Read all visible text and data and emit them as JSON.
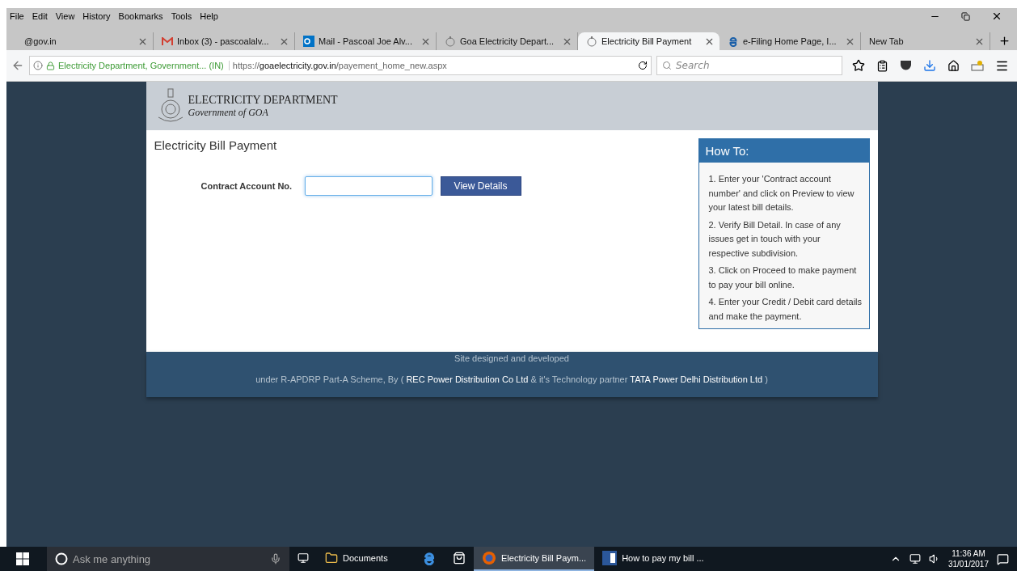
{
  "menu_bar": [
    "File",
    "Edit",
    "View",
    "History",
    "Bookmarks",
    "Tools",
    "Help"
  ],
  "tabs": [
    {
      "label": "@gov.in",
      "selected": false
    },
    {
      "label": "Inbox (3) - pascoalalv...",
      "selected": false
    },
    {
      "label": "Mail - Pascoal Joe Alv...",
      "selected": false
    },
    {
      "label": "Goa Electricity Depart...",
      "selected": false
    },
    {
      "label": "Electricity Bill Payment",
      "selected": true
    },
    {
      "label": "e-Filing Home Page, I...",
      "selected": false
    },
    {
      "label": "New Tab",
      "selected": false
    }
  ],
  "address_bar": {
    "site_identity": "Electricity Department, Government... (IN)",
    "url_prefix": "https://",
    "url_domain": "goaelectricity.gov.in",
    "url_path": "/payement_home_new.aspx"
  },
  "search": {
    "placeholder": "Search"
  },
  "page": {
    "header": {
      "title": "ELECTRICITY DEPARTMENT",
      "subtitle": "Government of GOA"
    },
    "heading": "Electricity Bill Payment",
    "form": {
      "label": "Contract Account No.",
      "button": "View Details"
    },
    "how_to": {
      "title": "How To:",
      "steps": [
        "1. Enter your 'Contract account number' and click on Preview to view your latest bill details.",
        "2. Verify Bill Detail. In case of any issues get in touch with your respective subdivision.",
        "3. Click on Proceed to make payment to pay your bill online.",
        "4. Enter your Credit / Debit card details and make the payment."
      ]
    },
    "footer": {
      "line_1": "Site designed and developed",
      "line_2": [
        {
          "kind": "plain",
          "text": "under R-APDRP Part-A Scheme, By ("
        },
        {
          "kind": "link",
          "text": "REC Power Distribution Co Ltd"
        },
        {
          "kind": "plain",
          "text": "& it's Technology partner"
        },
        {
          "kind": "link",
          "text": "TATA Power Delhi Distribution Ltd"
        },
        {
          "kind": "plain",
          "text": ")"
        }
      ]
    }
  },
  "taskbar": {
    "search_placeholder": "Ask me anything",
    "items": [
      {
        "kind": "task_view",
        "selected": false
      },
      {
        "kind": "folder",
        "label": "Documents",
        "selected": false
      },
      {
        "kind": "edge",
        "selected": false
      },
      {
        "kind": "store",
        "selected": false
      },
      {
        "kind": "firefox",
        "label": "Electricity Bill Paym...",
        "selected": true
      },
      {
        "kind": "word",
        "label": "How to pay my bill ...",
        "selected": false
      }
    ],
    "time": "11:36 AM",
    "date": "31/01/2017"
  }
}
